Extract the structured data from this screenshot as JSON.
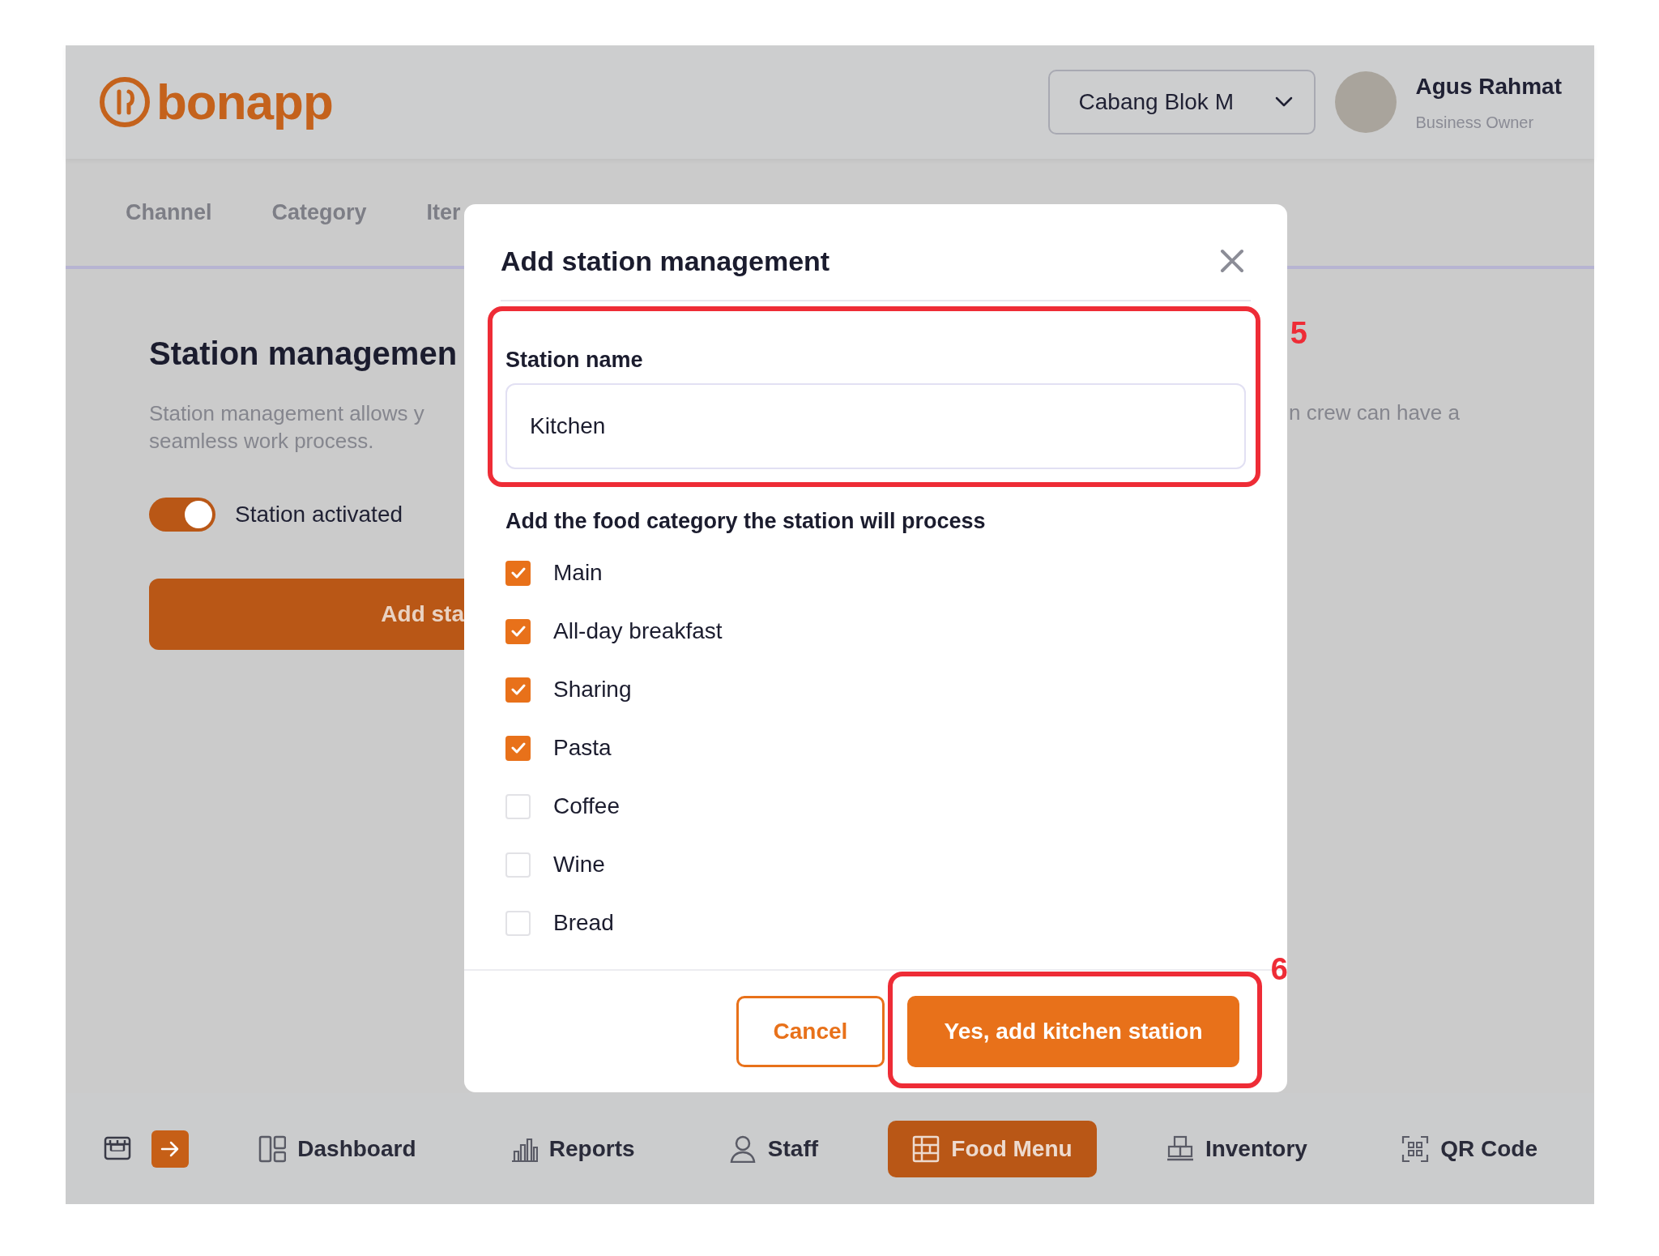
{
  "header": {
    "logo": "bonapp",
    "branch_select": {
      "value": "Cabang Blok M"
    },
    "user": {
      "name": "Agus Rahmat",
      "role": "Business Owner"
    }
  },
  "tabs": [
    {
      "label": "Channel"
    },
    {
      "label": "Category"
    },
    {
      "label": "Iter"
    }
  ],
  "page": {
    "title": "Station managemen",
    "description": "Station management allows y\nseamless work process.",
    "description_right": "n crew can have a",
    "toggle": {
      "label": "Station activated",
      "on": true
    },
    "add_button": "Add sta"
  },
  "modal": {
    "title": "Add station management",
    "station_name": {
      "label": "Station name",
      "value": "Kitchen"
    },
    "categories_label": "Add the food category the station will process",
    "categories": [
      {
        "label": "Main",
        "checked": true
      },
      {
        "label": "All-day breakfast",
        "checked": true
      },
      {
        "label": "Sharing",
        "checked": true
      },
      {
        "label": "Pasta",
        "checked": true
      },
      {
        "label": "Coffee",
        "checked": false
      },
      {
        "label": "Wine",
        "checked": false
      },
      {
        "label": "Bread",
        "checked": false
      }
    ],
    "buttons": [
      {
        "label": "Cancel",
        "kind": "secondary"
      },
      {
        "label": "Yes, add kitchen station",
        "kind": "primary"
      }
    ]
  },
  "annotations": [
    {
      "number": "5"
    },
    {
      "number": "6"
    }
  ],
  "bottom_nav": [
    {
      "label": "Dashboard",
      "selected": false
    },
    {
      "label": "Reports",
      "selected": false
    },
    {
      "label": "Staff",
      "selected": false
    },
    {
      "label": "Food Menu",
      "selected": true
    },
    {
      "label": "Inventory",
      "selected": false
    },
    {
      "label": "QR Code",
      "selected": false
    }
  ]
}
